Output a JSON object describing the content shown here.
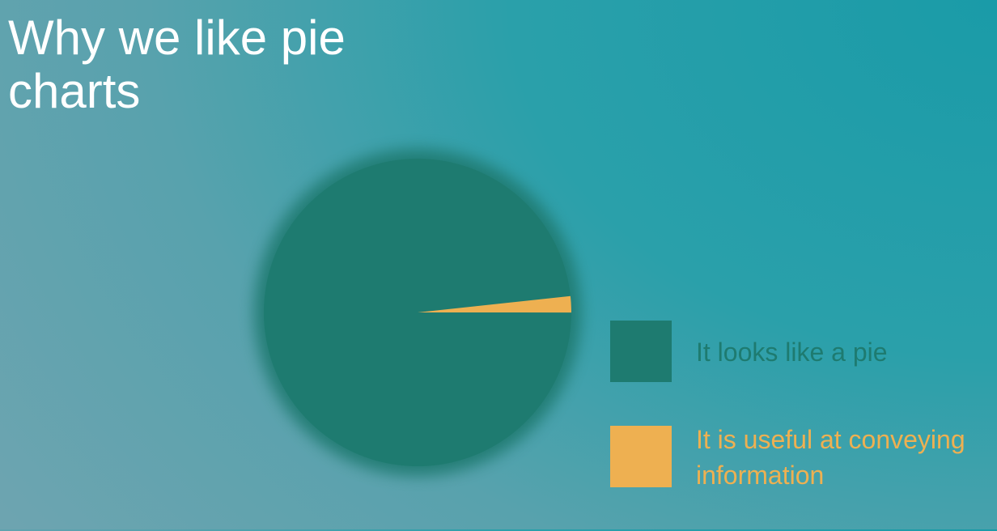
{
  "colors": {
    "background": "#2aa0aa",
    "title": "#ffffff",
    "pie_dark": "#1e7b70",
    "pie_light": "#eeb051"
  },
  "chart_data": {
    "type": "pie",
    "title": "Why we like pie charts",
    "legend_position": "right",
    "series": [
      {
        "labels": [
          "It looks like a pie",
          "It is useful at conveying information"
        ],
        "values": [
          98.3,
          1.7
        ],
        "colors": [
          "#1e7b70",
          "#eeb051"
        ]
      }
    ]
  }
}
